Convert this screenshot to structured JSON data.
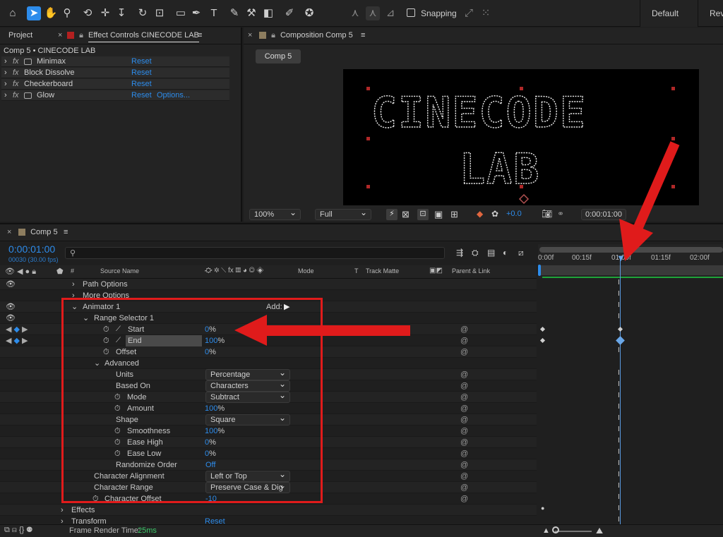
{
  "toolbar": {
    "snapping_label": "Snapping",
    "workspace_default": "Default",
    "workspace_review": "Revi",
    "icons": [
      "home-icon",
      "selection-tool-icon",
      "hand-tool-icon",
      "zoom-tool-icon",
      "orbit-camera-icon",
      "pan-camera-icon",
      "dolly-camera-icon",
      "rotate-tool-icon",
      "pan-behind-icon",
      "rectangle-tool-icon",
      "pen-tool-icon",
      "type-tool-icon",
      "brush-tool-icon",
      "clone-stamp-icon",
      "eraser-icon",
      "roto-brush-icon",
      "puppet-pin-icon"
    ]
  },
  "effect_controls": {
    "project_tab": "Project",
    "tab_title": "Effect Controls CINECODE LAB",
    "layer_path": "Comp 5 • CINECODE LAB",
    "effects": [
      {
        "name": "Minimax",
        "reset": "Reset",
        "options": ""
      },
      {
        "name": "Block Dissolve",
        "reset": "Reset",
        "options": ""
      },
      {
        "name": "Checkerboard",
        "reset": "Reset",
        "options": ""
      },
      {
        "name": "Glow",
        "reset": "Reset",
        "options": "Options..."
      }
    ]
  },
  "composition": {
    "tab_title": "Composition Comp 5",
    "comp_chip": "Comp 5",
    "text_line1": "CINECODE",
    "text_line2": "LAB",
    "zoom": "100%",
    "resolution": "Full",
    "exposure": "+0.0",
    "timecode": "0:00:01:00"
  },
  "timeline": {
    "tab_title": "Comp 5",
    "timecode": "0:00:01:00",
    "fps": "00030 (30.00 fps)",
    "search_placeholder": "",
    "columns": {
      "hash": "#",
      "source_name": "Source Name",
      "mode": "Mode",
      "t": "T",
      "track_matte": "Track Matte",
      "parent": "Parent & Link"
    },
    "ruler": [
      "0:00f",
      "00:15f",
      "01:00f",
      "01:15f",
      "02:00f"
    ],
    "rows": {
      "path_options": "Path Options",
      "more_options": "More Options",
      "animator": "Animator 1",
      "add_label": "Add:",
      "range_selector": "Range Selector 1",
      "start": {
        "label": "Start",
        "value": "0",
        "unit": "%"
      },
      "end": {
        "label": "End",
        "value": "100",
        "unit": "%"
      },
      "offset": {
        "label": "Offset",
        "value": "0",
        "unit": "%"
      },
      "advanced": "Advanced",
      "units": {
        "label": "Units",
        "value": "Percentage"
      },
      "based_on": {
        "label": "Based On",
        "value": "Characters"
      },
      "mode": {
        "label": "Mode",
        "value": "Subtract"
      },
      "amount": {
        "label": "Amount",
        "value": "100",
        "unit": "%"
      },
      "shape": {
        "label": "Shape",
        "value": "Square"
      },
      "smoothness": {
        "label": "Smoothness",
        "value": "100",
        "unit": "%"
      },
      "ease_high": {
        "label": "Ease High",
        "value": "0",
        "unit": "%"
      },
      "ease_low": {
        "label": "Ease Low",
        "value": "0",
        "unit": "%"
      },
      "randomize": {
        "label": "Randomize Order",
        "value": "Off"
      },
      "char_alignment": {
        "label": "Character Alignment",
        "value": "Left or Top"
      },
      "char_range": {
        "label": "Character Range",
        "value": "Preserve Case & Dig"
      },
      "char_offset": {
        "label": "Character Offset",
        "value": "-10"
      },
      "effects": "Effects",
      "transform": {
        "label": "Transform",
        "reset": "Reset"
      }
    },
    "footer": {
      "render_label": "Frame Render Time:",
      "render_value": "25ms"
    }
  },
  "colors": {
    "accent": "#2d8ceb",
    "annotation": "#e01b1b",
    "keyframe": "#6aa7e8"
  }
}
